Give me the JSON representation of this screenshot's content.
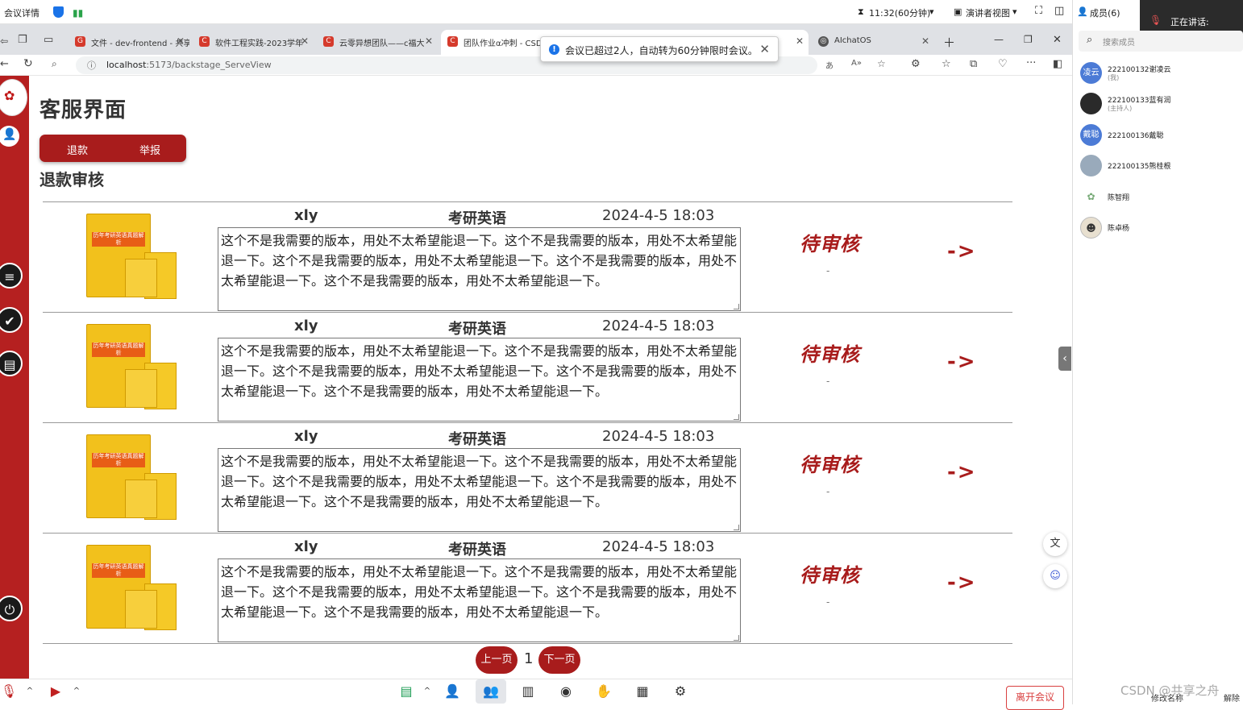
{
  "meeting": {
    "title": "会议详情",
    "time": "11:32(60分钟)",
    "view_mode": "演讲者视图",
    "members_label": "成员(6)",
    "speaking": "正在讲话:",
    "toast": "会议已超过2人，自动转为60分钟限时会议。",
    "leave": "离开会议",
    "toolbar": [
      "静音",
      "开启视频",
      "共享屏幕",
      "邀请",
      "成员(6)",
      "聊天",
      "录制",
      "互动",
      "应用",
      "设置"
    ],
    "search_placeholder": "搜索成员",
    "members": [
      {
        "name": "222100132谢凌云",
        "tag": "(我)",
        "avatar": "凌云",
        "color": "#4c7bd6"
      },
      {
        "name": "222100133蓝有润",
        "tag": "(主持人)",
        "avatar": "",
        "color": "#2a2a2a"
      },
      {
        "name": "222100136戴聪",
        "tag": "",
        "avatar": "戴聪",
        "color": "#4c7bd6"
      },
      {
        "name": "222100135熊桂根",
        "tag": "",
        "avatar": "",
        "color": "#9ab"
      },
      {
        "name": "陈智翔",
        "tag": "",
        "avatar": "",
        "color": "#ffffff"
      },
      {
        "name": "陈卓杨",
        "tag": "",
        "avatar": "",
        "color": "#e8e0d0"
      }
    ],
    "panel_actions": [
      "修改名称",
      "解除"
    ]
  },
  "browser": {
    "tabs": [
      {
        "label": "文件 - dev-frontend - 共享"
      },
      {
        "label": "软件工程实践-2023学年"
      },
      {
        "label": "云零异想团队——c福大"
      },
      {
        "label": "团队作业α冲刺 - CSDN"
      },
      {
        "label": ""
      },
      {
        "label": "AIchatOS"
      }
    ],
    "url_host": "localhost",
    "url_path": ":5173/backstage_ServeView"
  },
  "page": {
    "title": "客服界面",
    "tab_refund": "退款",
    "tab_report": "举报",
    "section_title": "退款审核",
    "rows": [
      {
        "user": "xly",
        "course": "考研英语",
        "date": "2024-4-5 18:03",
        "reason": "这个不是我需要的版本，用处不太希望能退一下。这个不是我需要的版本，用处不太希望能退一下。这个不是我需要的版本，用处不太希望能退一下。这个不是我需要的版本，用处不太希望能退一下。这个不是我需要的版本，用处不太希望能退一下。",
        "status": "待审核",
        "sub": "-",
        "arrow": "->"
      },
      {
        "user": "xly",
        "course": "考研英语",
        "date": "2024-4-5 18:03",
        "reason": "这个不是我需要的版本，用处不太希望能退一下。这个不是我需要的版本，用处不太希望能退一下。这个不是我需要的版本，用处不太希望能退一下。这个不是我需要的版本，用处不太希望能退一下。这个不是我需要的版本，用处不太希望能退一下。",
        "status": "待审核",
        "sub": "-",
        "arrow": "->"
      },
      {
        "user": "xly",
        "course": "考研英语",
        "date": "2024-4-5 18:03",
        "reason": "这个不是我需要的版本，用处不太希望能退一下。这个不是我需要的版本，用处不太希望能退一下。这个不是我需要的版本，用处不太希望能退一下。这个不是我需要的版本，用处不太希望能退一下。这个不是我需要的版本，用处不太希望能退一下。",
        "status": "待审核",
        "sub": "-",
        "arrow": "->"
      },
      {
        "user": "xly",
        "course": "考研英语",
        "date": "2024-4-5 18:03",
        "reason": "这个不是我需要的版本，用处不太希望能退一下。这个不是我需要的版本，用处不太希望能退一下。这个不是我需要的版本，用处不太希望能退一下。这个不是我需要的版本，用处不太希望能退一下。这个不是我需要的版本，用处不太希望能退一下。",
        "status": "待审核",
        "sub": "-",
        "arrow": "->"
      }
    ],
    "prev": "上一页",
    "page_number": "1",
    "next": "下一页"
  },
  "watermark": "CSDN @共享之舟",
  "colors": {
    "brand_red": "#a81c1c",
    "sidebar_red": "#b52020"
  }
}
